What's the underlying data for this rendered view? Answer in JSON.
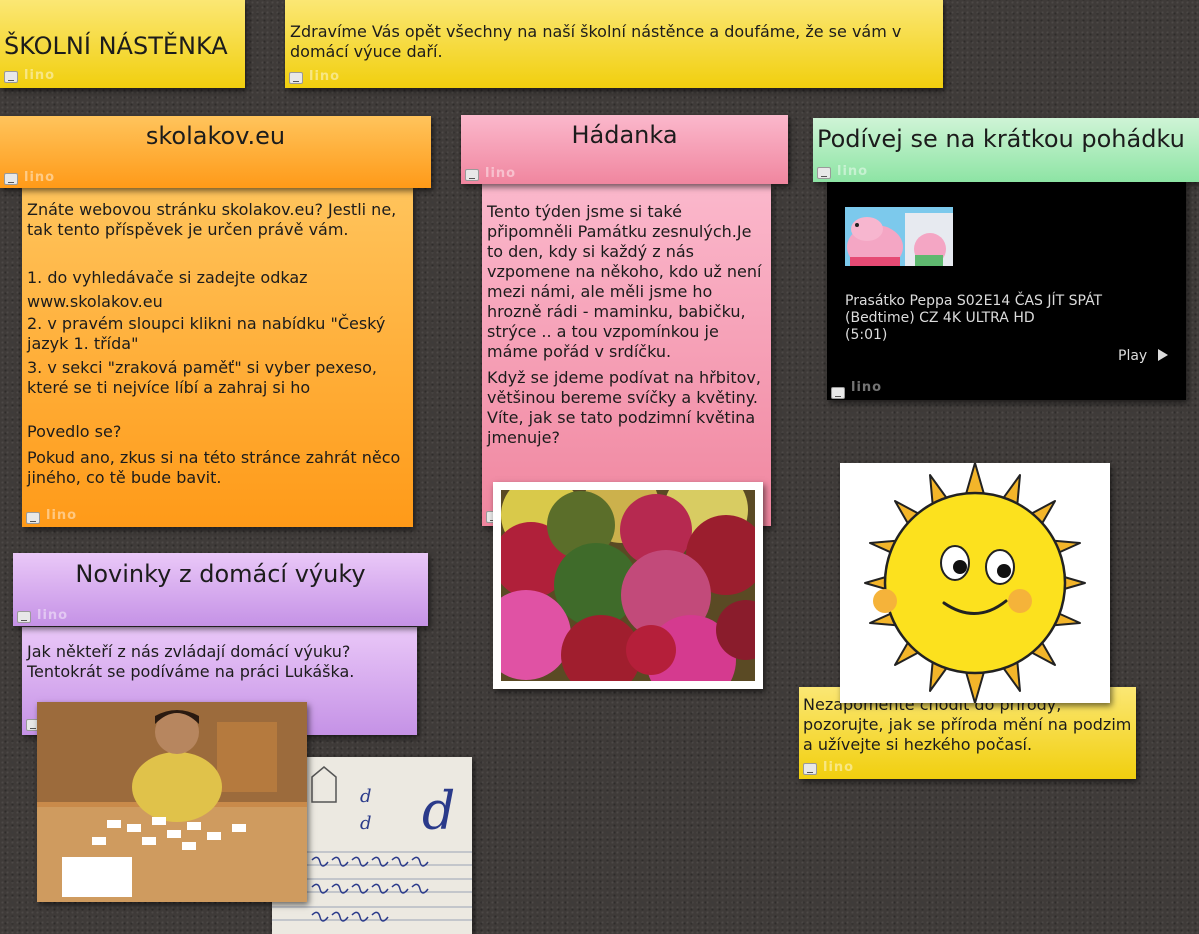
{
  "board": {
    "title": "ŠKOLNÍ NÁSTĚNKA",
    "welcome": "Zdravíme Vás opět všechny na naší školní nástěnce a doufáme, že se vám v domácí výuce daří."
  },
  "skolakov": {
    "title": "skolakov.eu",
    "p1": "Znáte webovou stránku skolakov.eu? Jestli ne, tak tento příspěvek je určen právě vám.",
    "s1": "1. do vyhledávače si zadejte odkaz",
    "s1b": "www.skolakov.eu",
    "s2": "2. v pravém sloupci klikni na nabídku \"Český jazyk 1. třída\"",
    "s3": "3. v sekci \"zraková paměť\" si vyber pexeso, které se ti nejvíce líbí a zahraj si ho",
    "q": "Povedlo se?",
    "p2": "Pokud ano, zkus si na této stránce zahrát něco jiného, co tě bude bavit."
  },
  "hadanka": {
    "title": "Hádanka",
    "p1": "Tento týden jsme si také připomněli Památku zesnulých.Je to den, kdy si každý z nás vzpomene na někoho, kdo už není mezi námi, ale měli jsme ho hrozně rádi - maminku, babičku, strýce .. a tou vzpomínkou je máme pořád v srdíčku.",
    "p2": "Když se jdeme podívat na hřbitov, většinou bereme svíčky a květiny. Víte, jak se tato podzimní květina jmenuje?"
  },
  "pohadka": {
    "title": "Podívej se na krátkou pohádku",
    "video_title": "Prasátko Peppa S02E14 ČAS JÍT SPÁT (Bedtime) CZ 4K ULTRA HD",
    "duration": "(5:01)",
    "play_label": "Play"
  },
  "novinky": {
    "title": "Novinky z domácí výuky",
    "text": "Jak někteří z nás zvládají domácí výuku? Tentokrát se podíváme na práci Lukáška."
  },
  "priroda": {
    "text": "Nezapomeňte chodit do přírody, pozorujte, jak se příroda mění na podzim a užívejte si hezkého počasí."
  },
  "worksheet": {
    "letter": "d"
  },
  "watermark": "lino",
  "colors": {
    "yellow": "#f1cf0e",
    "orange": "#ff9a18",
    "pink": "#f0869f",
    "purple": "#c592e6",
    "green": "#8de4a4",
    "board": "#3f3b39"
  }
}
